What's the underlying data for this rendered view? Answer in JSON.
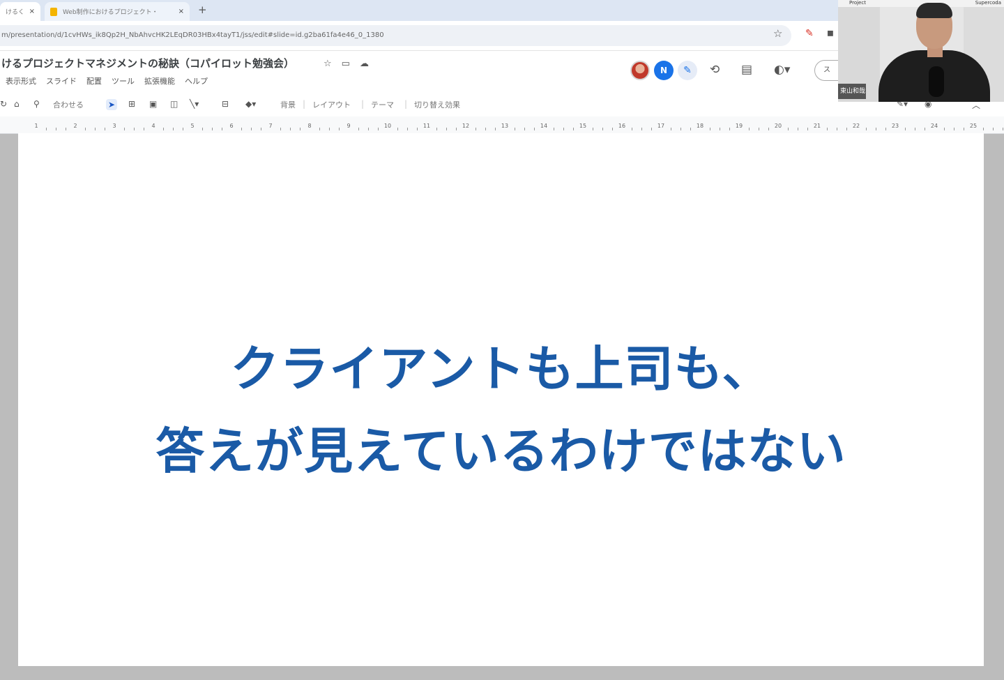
{
  "browser": {
    "tabs": [
      {
        "label": "けるく",
        "active": true
      },
      {
        "label": "Web制作におけるプロジェクト・",
        "active": false
      }
    ],
    "new_tab_label": "+",
    "close_glyph": "×",
    "url": "m/presentation/d/1cvHWs_ik8Qp2H_NbAhvcHK2LEqDR03HBx4tayT1/jss/edit#slide=id.g2ba61fa4e46_0_1380"
  },
  "slides_app": {
    "document_title": "けるプロジェクトマネジメントの秘訣（コパイロット勉強会）",
    "menus": [
      "表示形式",
      "スライド",
      "配置",
      "ツール",
      "拡張機能",
      "ヘルプ"
    ],
    "avatar_initial": "N",
    "share_label": "ス",
    "toolbar": {
      "new_slide_label": "合わせる",
      "background_label": "背景",
      "layout_label": "レイアウト",
      "theme_label": "テーマ",
      "transition_label": "切り替え効果"
    },
    "ruler_numbers": [
      "1",
      "2",
      "3",
      "4",
      "5",
      "6",
      "7",
      "8",
      "9",
      "10",
      "11",
      "12",
      "13",
      "14",
      "15",
      "16",
      "17",
      "18",
      "19",
      "20",
      "21",
      "22",
      "23",
      "24",
      "25"
    ]
  },
  "slide": {
    "line1": "クライアントも上司も、",
    "line2": "答えが見えているわけではない",
    "text_color": "#1a5aa6"
  },
  "webcam": {
    "top_left_label": "Project",
    "top_right_label": "Supercoda",
    "name_tag": "東山和哉"
  }
}
